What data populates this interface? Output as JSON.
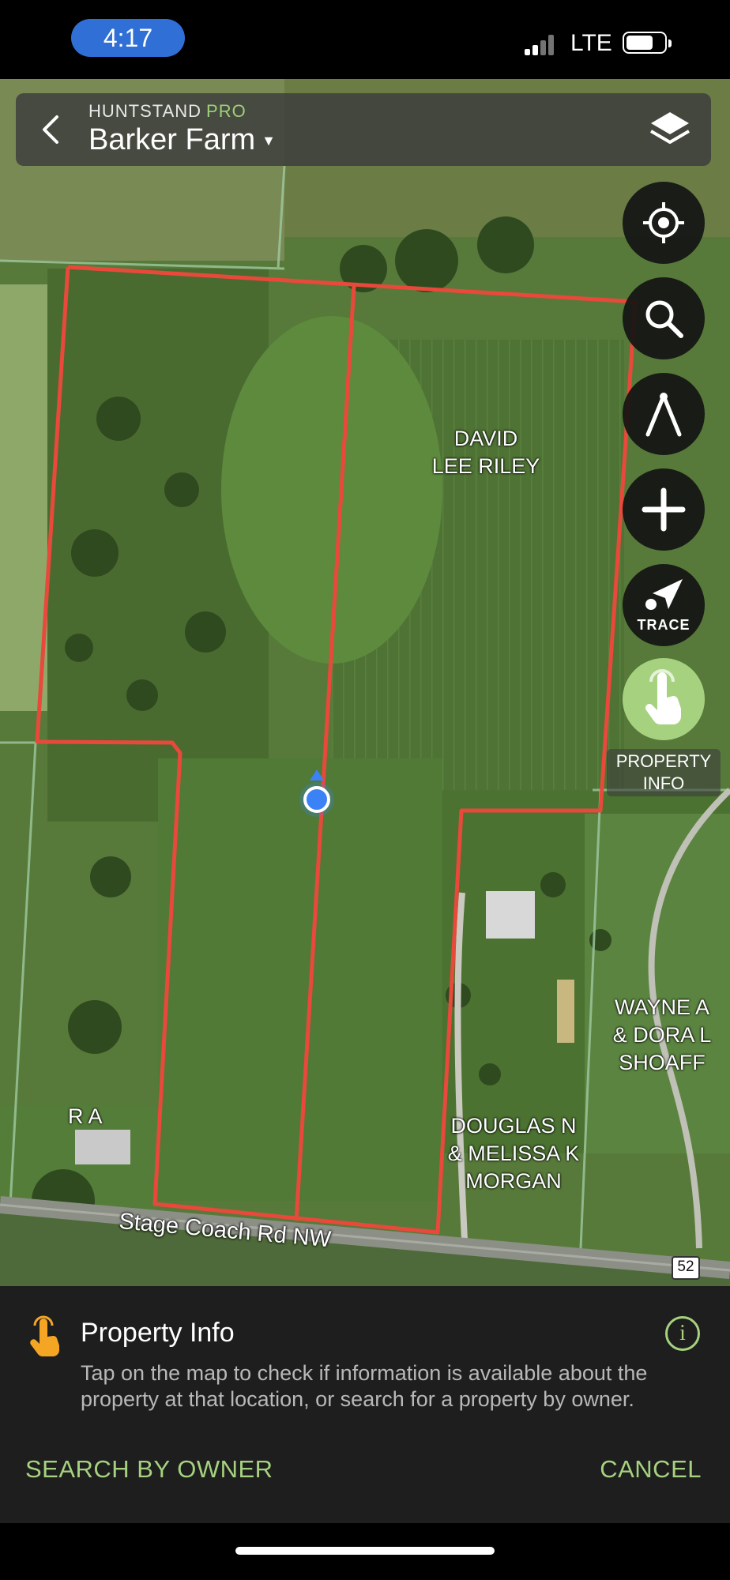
{
  "status_bar": {
    "time": "4:17",
    "network": "LTE"
  },
  "header": {
    "brand": "HUNTSTAND",
    "brand_tier": "PRO",
    "property_name": "Barker Farm"
  },
  "toolbar": {
    "trace_label": "TRACE",
    "property_info_label_line1": "PROPERTY",
    "property_info_label_line2": "INFO"
  },
  "map": {
    "parcels": {
      "riley_line1": "DAVID",
      "riley_line2": "LEE RILEY",
      "shoaff_line1": "WAYNE A",
      "shoaff_line2": "& DORA L",
      "shoaff_line3": "SHOAFF",
      "morgan_line1": "DOUGLAS N",
      "morgan_line2": "& MELISSA K",
      "morgan_line3": "MORGAN",
      "ra": "R A"
    },
    "road_name": "Stage Coach Rd NW",
    "route_shield": "52",
    "colors": {
      "boundary": "#e8493b",
      "location_dot": "#3b82f6"
    }
  },
  "panel": {
    "title": "Property Info",
    "description": "Tap on the map to check if information is available about the property at that location, or search for a property by owner.",
    "search_button": "SEARCH BY OWNER",
    "cancel_button": "CANCEL",
    "accent_color": "#a6d27f"
  }
}
